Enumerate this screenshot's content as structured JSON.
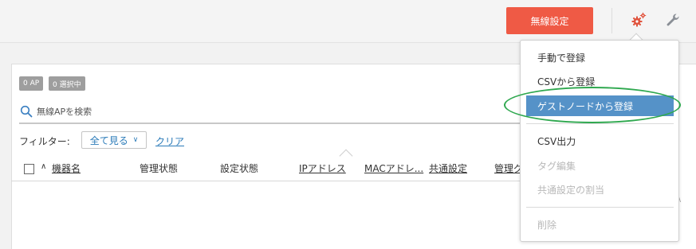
{
  "header": {
    "wireless_settings_label": "無線設定"
  },
  "badges": {
    "ap_count": "0 AP",
    "selected_count": "0 選択中"
  },
  "search": {
    "placeholder": "無線APを検索"
  },
  "filter": {
    "label": "フィルター:",
    "selected": "全て見る",
    "clear_label": "クリア"
  },
  "table": {
    "columns": [
      "機器名",
      "管理状態",
      "設定状態",
      "IPアドレス",
      "MACアドレ...",
      "共通設定",
      "管理グ"
    ]
  },
  "menu": {
    "items": [
      {
        "label": "手動で登録",
        "enabled": true
      },
      {
        "label": "CSVから登録",
        "enabled": true
      },
      {
        "label": "ゲストノードから登録",
        "enabled": true,
        "highlighted": true
      },
      {
        "label": "CSV出力",
        "enabled": true
      },
      {
        "label": "タグ編集",
        "enabled": false
      },
      {
        "label": "共通設定の割当",
        "enabled": false
      },
      {
        "label": "削除",
        "enabled": false
      }
    ]
  },
  "colors": {
    "primary_button": "#ef5a45",
    "highlight": "#5592c8",
    "link": "#2a7ab8",
    "annotation": "#2fa84f"
  }
}
